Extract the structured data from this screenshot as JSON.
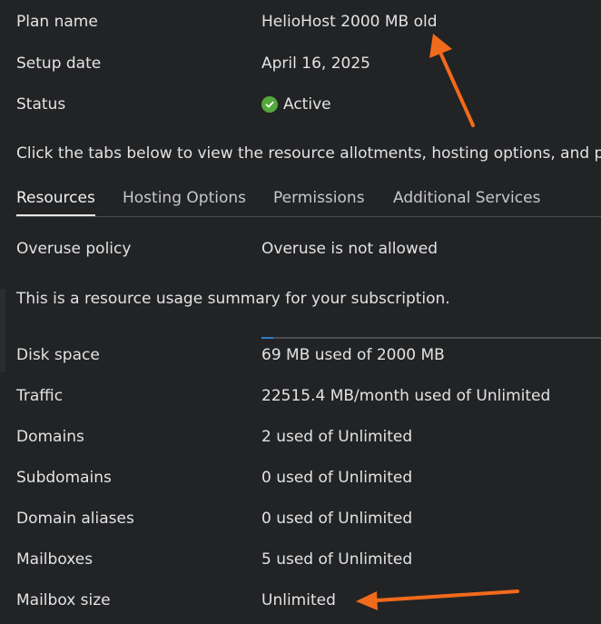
{
  "plan": {
    "plan_name_label": "Plan name",
    "plan_name_value": "HelioHost 2000 MB old",
    "setup_date_label": "Setup date",
    "setup_date_value": "April 16, 2025",
    "status_label": "Status",
    "status_value": "Active",
    "status_icon": "check-circle-icon",
    "status_color": "#53a83b"
  },
  "intro_text": "Click the tabs below to view the resource allotments, hosting options, and permissions",
  "tabs": [
    {
      "label": "Resources",
      "active": true
    },
    {
      "label": "Hosting Options",
      "active": false
    },
    {
      "label": "Permissions",
      "active": false
    },
    {
      "label": "Additional Services",
      "active": false
    }
  ],
  "overuse": {
    "label": "Overuse policy",
    "value": "Overuse is not allowed"
  },
  "summary_text": "This is a resource usage summary for your subscription.",
  "resources": [
    {
      "label": "Disk space",
      "value": "69 MB used of 2000 MB"
    },
    {
      "label": "Traffic",
      "value": "22515.4 MB/month used of Unlimited"
    },
    {
      "label": "Domains",
      "value": "2 used of Unlimited"
    },
    {
      "label": "Subdomains",
      "value": "0 used of Unlimited"
    },
    {
      "label": "Domain aliases",
      "value": "0 used of Unlimited"
    },
    {
      "label": "Mailboxes",
      "value": "5 used of Unlimited"
    },
    {
      "label": "Mailbox size",
      "value": "Unlimited"
    }
  ],
  "disk_usage_fraction": 0.0345,
  "colors": {
    "background": "#222325",
    "text": "#e3e3e3",
    "accent_blue": "#2e7fc1",
    "annotation_arrow": "#f26a1b"
  }
}
